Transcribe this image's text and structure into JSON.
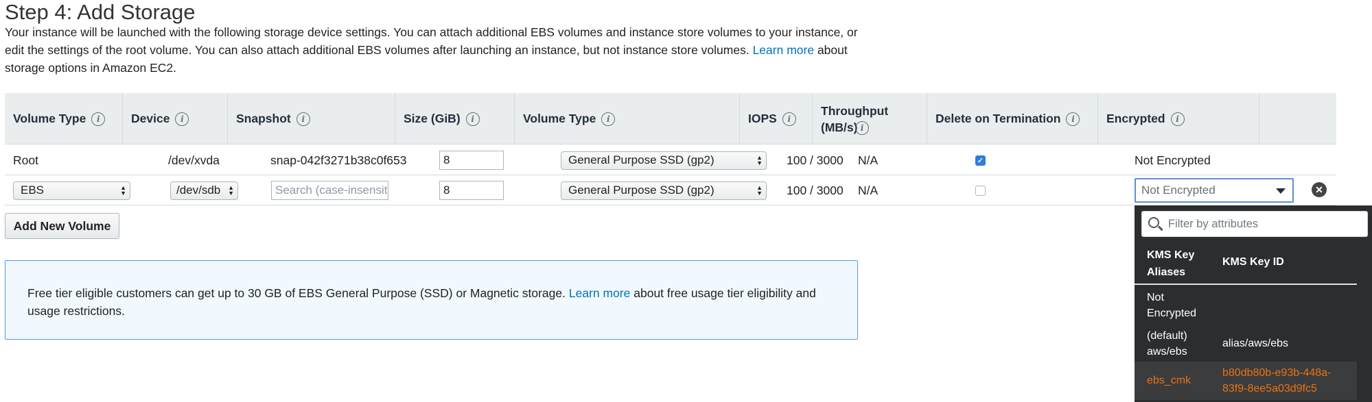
{
  "page": {
    "title": "Step 4: Add Storage",
    "intro_text": "Your instance will be launched with the following storage device settings. You can attach additional EBS volumes and instance store volumes to your instance, or edit the settings of the root volume. You can also attach additional EBS volumes after launching an instance, but not instance store volumes.",
    "intro_link": "Learn more",
    "intro_suffix": "about storage options in Amazon EC2."
  },
  "table": {
    "headers": {
      "volume_type": "Volume Type",
      "device": "Device",
      "snapshot": "Snapshot",
      "size": "Size (GiB)",
      "volume_type2": "Volume Type",
      "iops": "IOPS",
      "throughput": "Throughput (MB/s)",
      "delete": "Delete on Termination",
      "encrypted": "Encrypted"
    },
    "rows": [
      {
        "volume_type": "Root",
        "device": "/dev/xvda",
        "snapshot": "snap-042f3271b38c0f653",
        "size": "8",
        "ebs_type": "General Purpose SSD (gp2)",
        "iops": "100 / 3000",
        "throughput": "N/A",
        "delete_on_termination": true,
        "encrypted": "Not Encrypted"
      },
      {
        "volume_type": "EBS",
        "device": "/dev/sdb",
        "snapshot_placeholder": "Search (case-insensit",
        "size": "8",
        "ebs_type": "General Purpose SSD (gp2)",
        "iops": "100 / 3000",
        "throughput": "N/A",
        "delete_on_termination": false,
        "encrypted_placeholder": "Not Encrypted"
      }
    ]
  },
  "add_button": "Add New Volume",
  "free_tier": {
    "text": "Free tier eligible customers can get up to 30 GB of EBS General Purpose (SSD) or Magnetic storage.",
    "link": "Learn more",
    "suffix": "about free usage tier eligibility and usage restrictions."
  },
  "kms_dropdown": {
    "filter_placeholder": "Filter by attributes",
    "col_alias": "KMS Key Aliases",
    "col_id": "KMS Key ID",
    "options": [
      {
        "alias": "Not Encrypted",
        "key_id": ""
      },
      {
        "alias": "(default) aws/ebs",
        "key_id": "alias/aws/ebs"
      },
      {
        "alias": "ebs_cmk",
        "key_id": "b80db80b-e93b-448a-83f9-8ee5a03d9fc5"
      }
    ],
    "highlight_color": "#ec7211"
  },
  "icons": {
    "info": "info-icon",
    "remove": "remove-icon",
    "search": "search-icon",
    "dropdown": "caret-down-icon",
    "select_arrows": "select-arrows-icon",
    "checkbox": "checkbox-icon"
  }
}
